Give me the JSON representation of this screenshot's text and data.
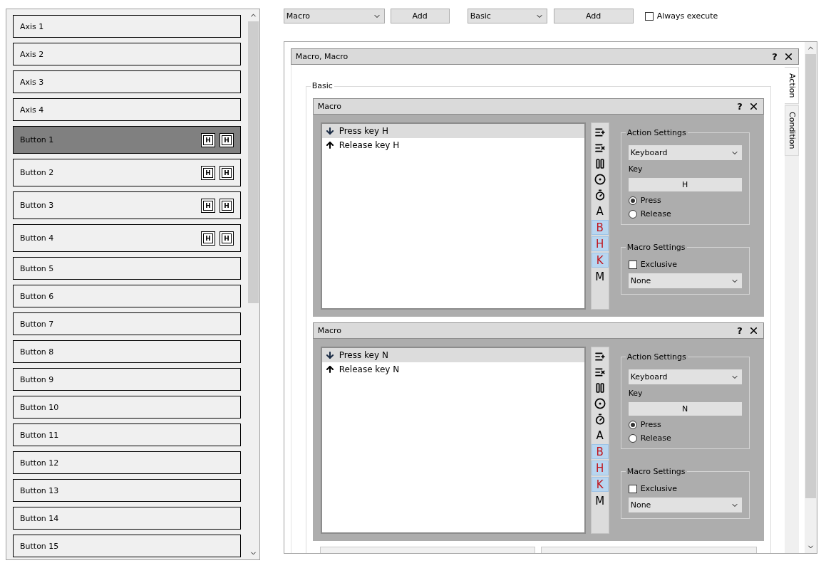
{
  "sidebar": {
    "items": [
      {
        "label": "Axis 1",
        "selected": false
      },
      {
        "label": "Axis 2",
        "selected": false
      },
      {
        "label": "Axis 3",
        "selected": false
      },
      {
        "label": "Axis 4",
        "selected": false
      },
      {
        "label": "Button 1",
        "selected": true,
        "badges": [
          "H",
          "H"
        ]
      },
      {
        "label": "Button 2",
        "selected": false,
        "badges": [
          "H",
          "H"
        ]
      },
      {
        "label": "Button 3",
        "selected": false,
        "badges": [
          "H",
          "H"
        ]
      },
      {
        "label": "Button 4",
        "selected": false,
        "badges": [
          "H",
          "H"
        ]
      },
      {
        "label": "Button 5",
        "selected": false
      },
      {
        "label": "Button 6",
        "selected": false
      },
      {
        "label": "Button 7",
        "selected": false
      },
      {
        "label": "Button 8",
        "selected": false
      },
      {
        "label": "Button 9",
        "selected": false
      },
      {
        "label": "Button 10",
        "selected": false
      },
      {
        "label": "Button 11",
        "selected": false
      },
      {
        "label": "Button 12",
        "selected": false
      },
      {
        "label": "Button 13",
        "selected": false
      },
      {
        "label": "Button 14",
        "selected": false
      },
      {
        "label": "Button 15",
        "selected": false
      }
    ]
  },
  "toolbar": {
    "action_type": "Macro",
    "add_action": "Add",
    "condition_type": "Basic",
    "add_condition": "Add",
    "always_execute": {
      "label": "Always execute",
      "checked": false
    }
  },
  "container": {
    "title": "Macro, Macro",
    "help": "?",
    "group_title": "Basic",
    "tabs": [
      {
        "label": "Action",
        "selected": true
      },
      {
        "label": "Condition",
        "selected": false
      }
    ],
    "macros": [
      {
        "title": "Macro",
        "help": "?",
        "steps": [
          {
            "kind": "press",
            "label": "Press key H",
            "selected": true
          },
          {
            "kind": "release",
            "label": "Release key H",
            "selected": false
          }
        ],
        "tools": [
          {
            "kind": "add"
          },
          {
            "kind": "remove"
          },
          {
            "kind": "pause"
          },
          {
            "kind": "record"
          },
          {
            "kind": "timer"
          },
          {
            "kind": "letter",
            "label": "A",
            "on": false
          },
          {
            "kind": "letter",
            "label": "B",
            "on": true
          },
          {
            "kind": "letter",
            "label": "H",
            "on": true
          },
          {
            "kind": "letter",
            "label": "K",
            "on": true
          },
          {
            "kind": "letter",
            "label": "M",
            "on": false
          }
        ],
        "action_settings": {
          "title": "Action Settings",
          "device": "Keyboard",
          "key_label": "Key",
          "key": "H",
          "modes": [
            {
              "label": "Press",
              "selected": true
            },
            {
              "label": "Release",
              "selected": false
            }
          ]
        },
        "macro_settings": {
          "title": "Macro Settings",
          "exclusive": {
            "label": "Exclusive",
            "checked": false
          },
          "repeat": "None"
        }
      },
      {
        "title": "Macro",
        "help": "?",
        "steps": [
          {
            "kind": "press",
            "label": "Press key N",
            "selected": true
          },
          {
            "kind": "release",
            "label": "Release key N",
            "selected": false
          }
        ],
        "tools": [
          {
            "kind": "add"
          },
          {
            "kind": "remove"
          },
          {
            "kind": "pause"
          },
          {
            "kind": "record"
          },
          {
            "kind": "timer"
          },
          {
            "kind": "letter",
            "label": "A",
            "on": false
          },
          {
            "kind": "letter",
            "label": "B",
            "on": true
          },
          {
            "kind": "letter",
            "label": "H",
            "on": true
          },
          {
            "kind": "letter",
            "label": "K",
            "on": true
          },
          {
            "kind": "letter",
            "label": "M",
            "on": false
          }
        ],
        "action_settings": {
          "title": "Action Settings",
          "device": "Keyboard",
          "key_label": "Key",
          "key": "N",
          "modes": [
            {
              "label": "Press",
              "selected": true
            },
            {
              "label": "Release",
              "selected": false
            }
          ]
        },
        "macro_settings": {
          "title": "Macro Settings",
          "exclusive": {
            "label": "Exclusive",
            "checked": false
          },
          "repeat": "None"
        }
      }
    ]
  }
}
